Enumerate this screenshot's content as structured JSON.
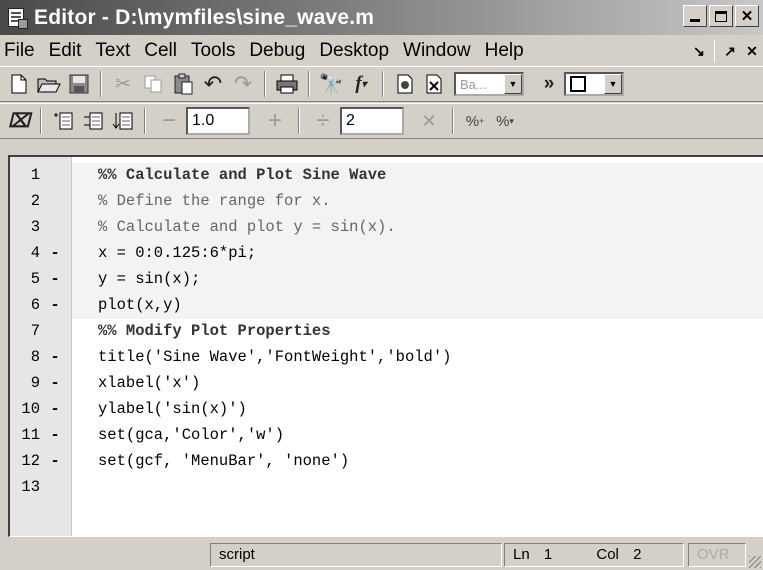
{
  "window": {
    "title": "Editor - D:\\mymfiles\\sine_wave.m"
  },
  "menu": {
    "items": [
      {
        "name": "menu-file",
        "label": "File"
      },
      {
        "name": "menu-edit",
        "label": "Edit"
      },
      {
        "name": "menu-text",
        "label": "Text"
      },
      {
        "name": "menu-cell",
        "label": "Cell"
      },
      {
        "name": "menu-tools",
        "label": "Tools"
      },
      {
        "name": "menu-debug",
        "label": "Debug"
      },
      {
        "name": "menu-desktop",
        "label": "Desktop"
      },
      {
        "name": "menu-window",
        "label": "Window"
      },
      {
        "name": "menu-help",
        "label": "Help"
      }
    ],
    "extra_glyphs": [
      "↘",
      "↗",
      "✕"
    ]
  },
  "toolbar1": {
    "stack_combo_value": "Ba...",
    "more_label": "»",
    "icons": [
      "new-file-icon",
      "open-file-icon",
      "save-icon",
      "cut-icon",
      "copy-icon",
      "paste-icon",
      "undo-icon",
      "redo-icon",
      "print-icon",
      "find-icon",
      "function-icon",
      "breakpoint-icon",
      "clear-breakpoints-icon"
    ]
  },
  "toolbar2": {
    "decrement_value": "1.0",
    "divide_value": "2",
    "icons": [
      "cell-mode-icon",
      "insert-cell-icon",
      "evaluate-cell-icon",
      "evaluate-and-advance-icon",
      "minus-icon",
      "plus-icon",
      "divide-icon",
      "multiply-icon",
      "comment-icon",
      "uncomment-icon"
    ]
  },
  "editor": {
    "lines": [
      {
        "n": "1",
        "mark": "",
        "code": "%% Calculate and Plot Sine Wave"
      },
      {
        "n": "2",
        "mark": "",
        "code": "% Define the range for x."
      },
      {
        "n": "3",
        "mark": "",
        "code": "% Calculate and plot y = sin(x)."
      },
      {
        "n": "4",
        "mark": "-",
        "code": "x = 0:0.125:6*pi;"
      },
      {
        "n": "5",
        "mark": "-",
        "code": "y = sin(x);"
      },
      {
        "n": "6",
        "mark": "-",
        "code": "plot(x,y)"
      },
      {
        "n": "7",
        "mark": "",
        "code": "%% Modify Plot Properties"
      },
      {
        "n": "8",
        "mark": "-",
        "code": "title('Sine Wave','FontWeight','bold')"
      },
      {
        "n": "9",
        "mark": "-",
        "code": "xlabel('x')"
      },
      {
        "n": "10",
        "mark": "-",
        "code": "ylabel('sin(x)')"
      },
      {
        "n": "11",
        "mark": "-",
        "code": "set(gca,'Color','w')"
      },
      {
        "n": "12",
        "mark": "-",
        "code": "set(gcf, 'MenuBar', 'none')"
      },
      {
        "n": "13",
        "mark": "",
        "code": ""
      }
    ]
  },
  "status": {
    "file_type": "script",
    "ln_label": "Ln",
    "ln_value": "1",
    "col_label": "Col",
    "col_value": "2",
    "ovr": "OVR"
  }
}
